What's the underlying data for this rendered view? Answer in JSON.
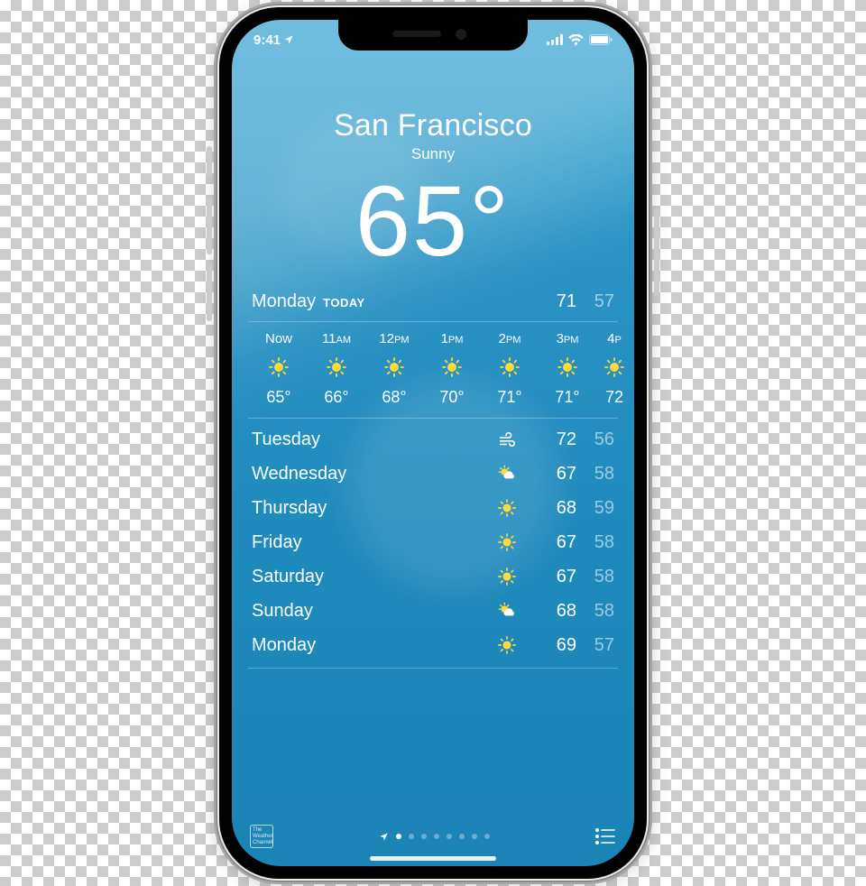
{
  "status": {
    "time": "9:41"
  },
  "hero": {
    "city": "San Francisco",
    "condition": "Sunny",
    "temp": "65°"
  },
  "today": {
    "day": "Monday",
    "tag": "TODAY",
    "hi": "71",
    "lo": "57"
  },
  "hourly": [
    {
      "time": "Now",
      "ampm": "",
      "icon": "sun",
      "temp": "65°"
    },
    {
      "time": "11",
      "ampm": "AM",
      "icon": "sun",
      "temp": "66°"
    },
    {
      "time": "12",
      "ampm": "PM",
      "icon": "sun",
      "temp": "68°"
    },
    {
      "time": "1",
      "ampm": "PM",
      "icon": "sun",
      "temp": "70°"
    },
    {
      "time": "2",
      "ampm": "PM",
      "icon": "sun",
      "temp": "71°"
    },
    {
      "time": "3",
      "ampm": "PM",
      "icon": "sun",
      "temp": "71°"
    },
    {
      "time": "4",
      "ampm": "P",
      "icon": "sun",
      "temp": "72"
    }
  ],
  "daily": [
    {
      "name": "Tuesday",
      "icon": "wind",
      "hi": "72",
      "lo": "56"
    },
    {
      "name": "Wednesday",
      "icon": "partly",
      "hi": "67",
      "lo": "58"
    },
    {
      "name": "Thursday",
      "icon": "sun",
      "hi": "68",
      "lo": "59"
    },
    {
      "name": "Friday",
      "icon": "sun",
      "hi": "67",
      "lo": "58"
    },
    {
      "name": "Saturday",
      "icon": "sun",
      "hi": "67",
      "lo": "58"
    },
    {
      "name": "Sunday",
      "icon": "partly",
      "hi": "68",
      "lo": "58"
    },
    {
      "name": "Monday",
      "icon": "sun",
      "hi": "69",
      "lo": "57"
    }
  ],
  "pager": {
    "count": 8,
    "active": 0
  }
}
